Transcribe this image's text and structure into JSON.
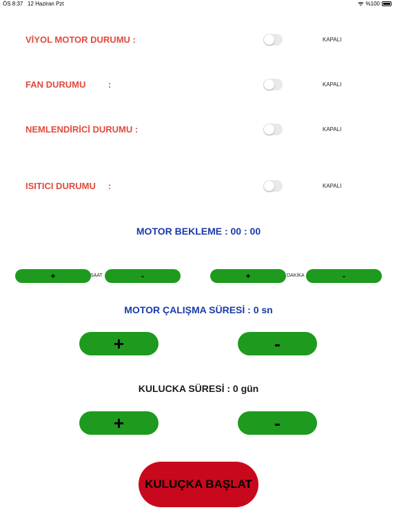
{
  "status_bar": {
    "time": "ÖS 8:37",
    "date": "12 Haziran Pzt",
    "battery": "%100"
  },
  "rows": [
    {
      "label": "VİYOL MOTOR DURUMU :",
      "state": "KAPALI",
      "on": false
    },
    {
      "label": "FAN DURUMU         :",
      "state": "KAPALI",
      "on": false
    },
    {
      "label": "NEMLENDİRİCİ DURUMU :",
      "state": "KAPALI",
      "on": false
    },
    {
      "label": "ISITICI DURUMU     :",
      "state": "KAPALI",
      "on": false
    }
  ],
  "motor_wait": {
    "heading": "MOTOR BEKLEME : 00 : 00",
    "hour_unit": "SAAT",
    "minute_unit": "DAKİKA",
    "plus": "+",
    "minus": "-"
  },
  "motor_run": {
    "heading": "MOTOR ÇALIŞMA SÜRESİ : 0 sn",
    "plus": "+",
    "minus": "-"
  },
  "incubation": {
    "heading": "KULUCKA SÜRESİ : 0 gün",
    "plus": "+",
    "minus": "-"
  },
  "start_button": "KULUÇKA BAŞLAT",
  "colors": {
    "label_red": "#e24a3b",
    "heading_blue": "#1a3aa8",
    "button_green": "#1e9a1e",
    "start_red": "#c8091d"
  }
}
